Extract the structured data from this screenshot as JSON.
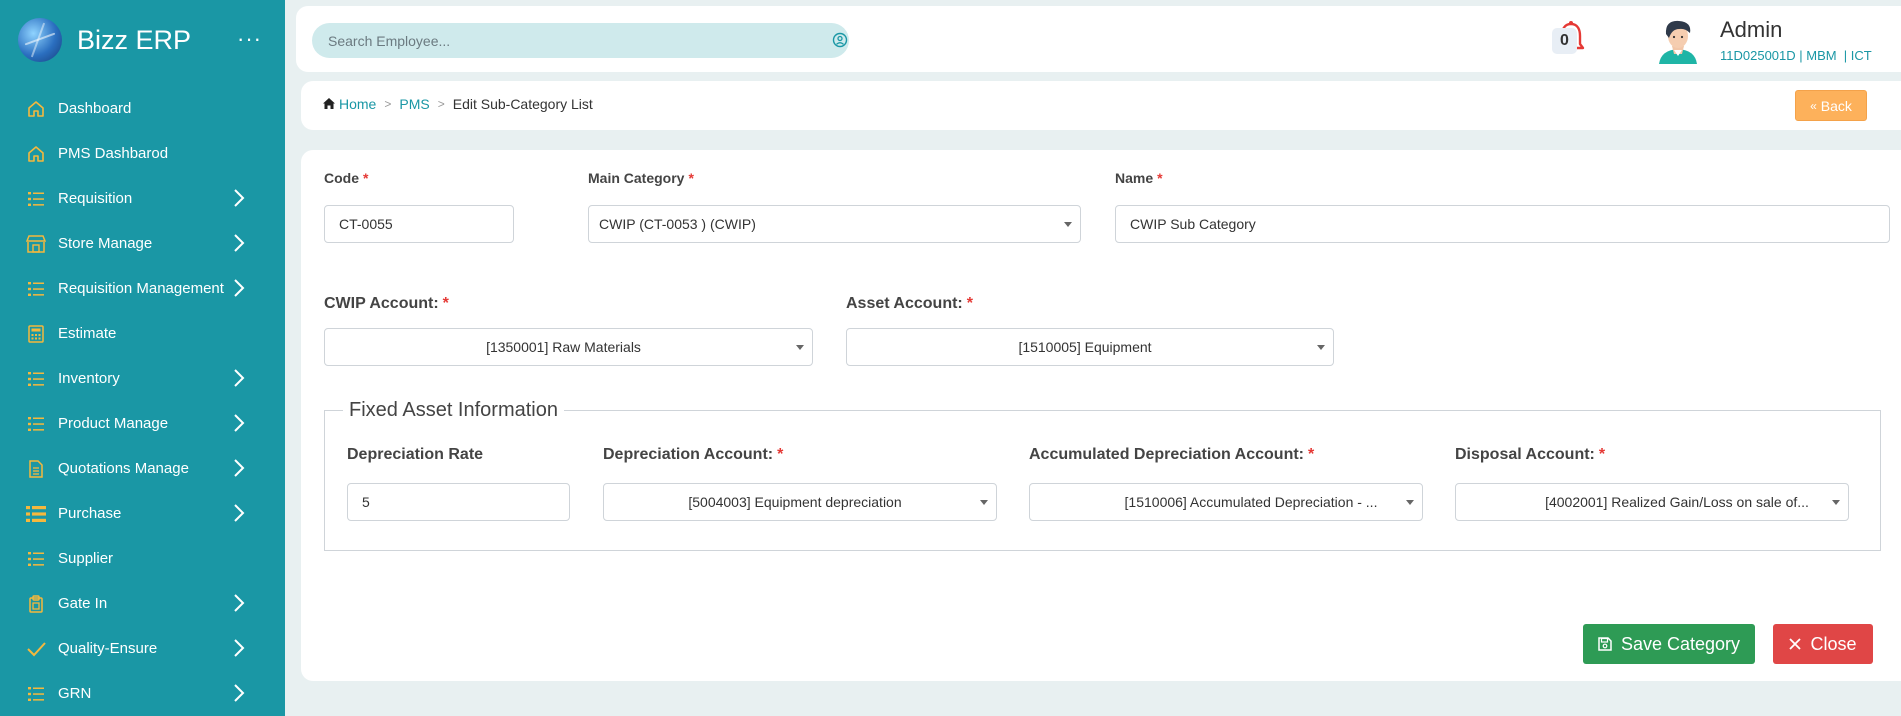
{
  "brand": {
    "name": "Bizz ERP",
    "menu_dots": "···"
  },
  "sidebar": {
    "items": [
      {
        "label": "Dashboard",
        "icon": "home-icon",
        "has_chevron": false
      },
      {
        "label": "PMS Dashbarod",
        "icon": "home-icon",
        "has_chevron": false
      },
      {
        "label": "Requisition",
        "icon": "list-icon",
        "has_chevron": true
      },
      {
        "label": "Store Manage",
        "icon": "store-icon",
        "has_chevron": true
      },
      {
        "label": "Requisition Management",
        "icon": "list-icon",
        "has_chevron": true
      },
      {
        "label": "Estimate",
        "icon": "calculator-icon",
        "has_chevron": false
      },
      {
        "label": "Inventory",
        "icon": "list-icon",
        "has_chevron": true
      },
      {
        "label": "Product Manage",
        "icon": "list-icon",
        "has_chevron": true
      },
      {
        "label": "Quotations Manage",
        "icon": "document-icon",
        "has_chevron": true
      },
      {
        "label": "Purchase",
        "icon": "list-bold-icon",
        "has_chevron": true
      },
      {
        "label": "Supplier",
        "icon": "list-icon",
        "has_chevron": false
      },
      {
        "label": "Gate In",
        "icon": "clipboard-icon",
        "has_chevron": true
      },
      {
        "label": "Quality-Ensure",
        "icon": "check-icon",
        "has_chevron": true
      },
      {
        "label": "GRN",
        "icon": "list-icon",
        "has_chevron": true
      }
    ]
  },
  "header": {
    "search_placeholder": "Search Employee...",
    "notification_count": "0",
    "user_name": "Admin",
    "user_meta": "11D025001D | MBM  | ICT"
  },
  "breadcrumb": {
    "home": "Home",
    "section": "PMS",
    "current": "Edit Sub-Category List",
    "back_label": "Back"
  },
  "form": {
    "code": {
      "label": "Code",
      "value": "CT-0055"
    },
    "main_category": {
      "label": "Main Category",
      "value": "CWIP (CT-0053 ) (CWIP)"
    },
    "name": {
      "label": "Name",
      "value": "CWIP Sub Category"
    },
    "cwip_account": {
      "label": "CWIP Account:",
      "value": "[1350001] Raw Materials"
    },
    "asset_account": {
      "label": "Asset Account:",
      "value": "[1510005] Equipment"
    },
    "fixed_asset": {
      "legend": "Fixed Asset Information",
      "depreciation_rate": {
        "label": "Depreciation Rate",
        "value": "5"
      },
      "depreciation_account": {
        "label": "Depreciation Account:",
        "value": "[5004003] Equipment depreciation"
      },
      "accumulated_account": {
        "label": "Accumulated Depreciation Account:",
        "value": "[1510006] Accumulated Depreciation - ..."
      },
      "disposal_account": {
        "label": "Disposal Account:",
        "value": "[4002001] Realized Gain/Loss on sale of..."
      }
    },
    "required_mark": "*",
    "save_label": "Save Category",
    "close_label": "Close"
  },
  "colors": {
    "sidebar": "#1a97a5",
    "icon_accent": "#f5b83d",
    "save": "#2e9b55",
    "close": "#e04646",
    "back": "#fdb15b"
  }
}
